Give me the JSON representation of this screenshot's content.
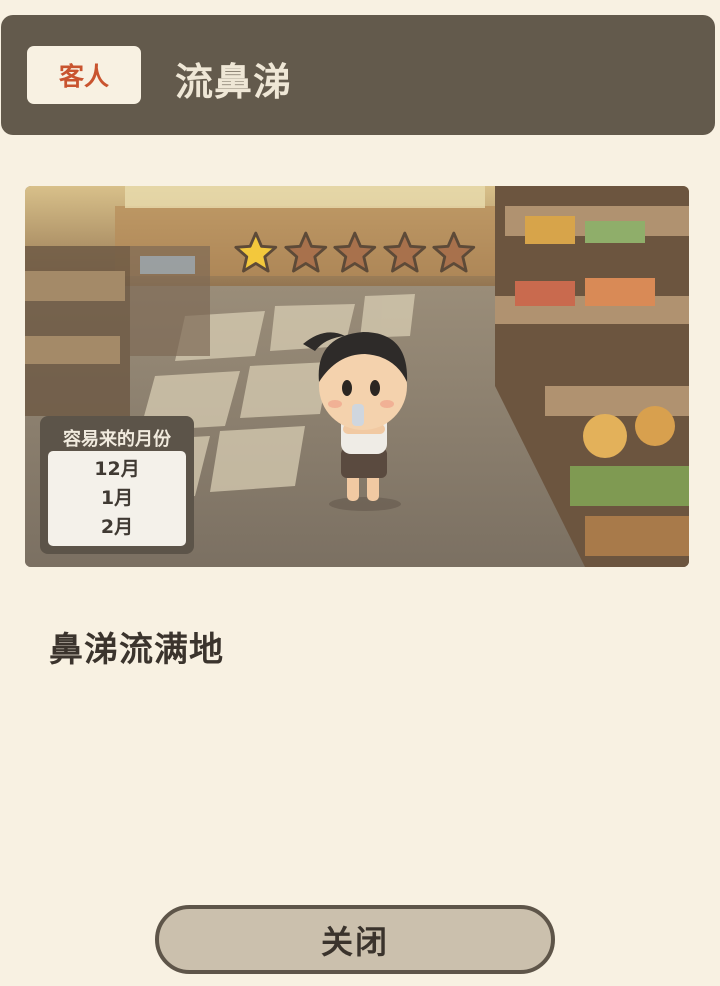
{
  "header": {
    "tag_label": "客人",
    "title": "流鼻涕"
  },
  "rating": {
    "value": 1,
    "max": 5,
    "filled_color": "#f3c83c",
    "empty_color": "#a8714c"
  },
  "months_panel": {
    "title": "容易来的月份",
    "months": [
      "12月",
      "1月",
      "2月"
    ]
  },
  "description": "鼻涕流满地",
  "close_button_label": "关闭",
  "colors": {
    "header_bg": "#635a4c",
    "tag_text": "#c9542f",
    "page_bg": "#f8f1e2"
  }
}
